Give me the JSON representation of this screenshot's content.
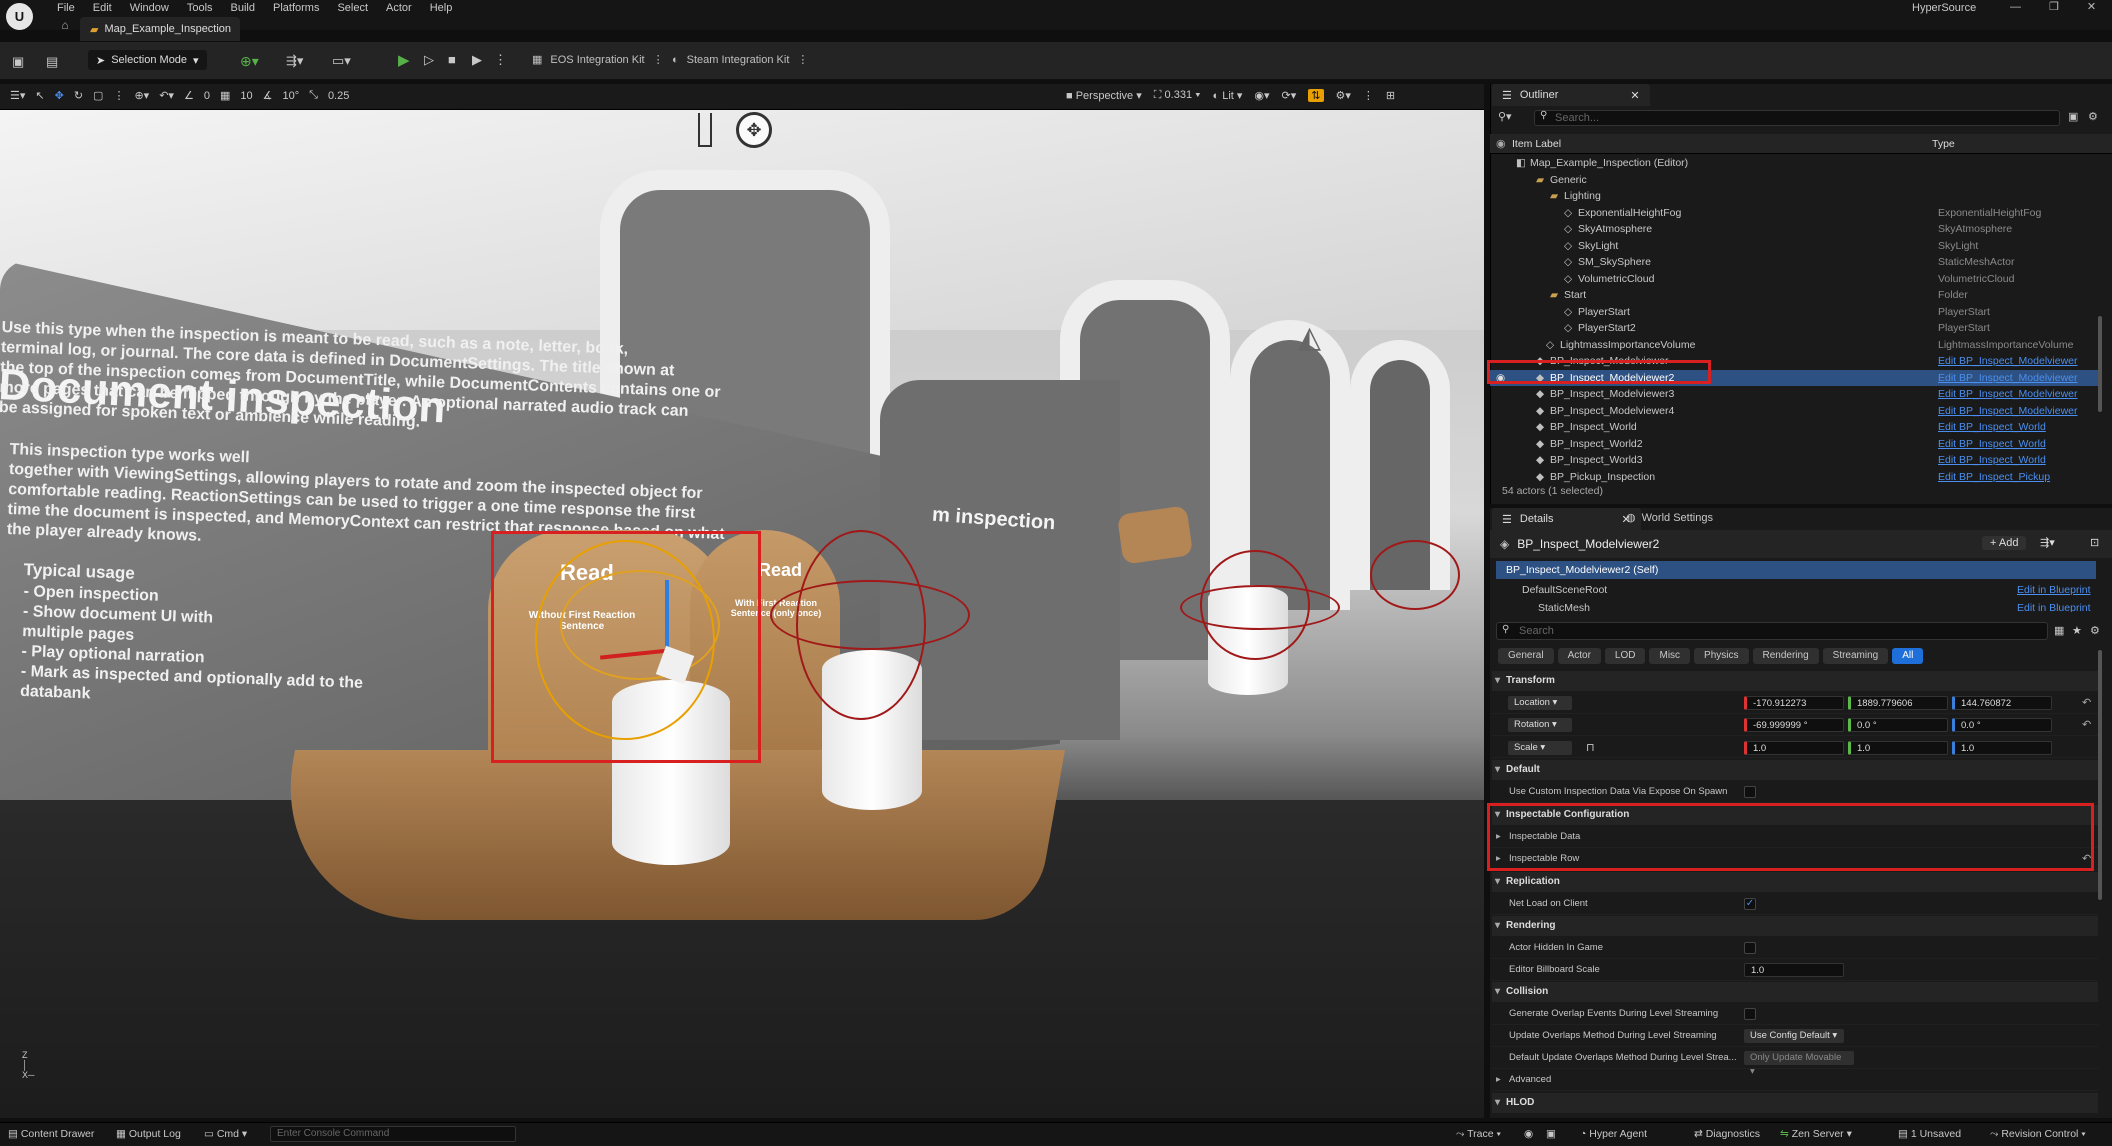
{
  "app": {
    "title": "HyperSource",
    "window_controls": [
      "—",
      "❐",
      "✕"
    ]
  },
  "menu": [
    "File",
    "Edit",
    "Window",
    "Tools",
    "Build",
    "Platforms",
    "Select",
    "Actor",
    "Help"
  ],
  "tab": {
    "label": "Map_Example_Inspection"
  },
  "toolbar": {
    "selection_mode": "Selection Mode",
    "eos": "EOS Integration Kit",
    "steam": "Steam Integration Kit"
  },
  "viewport_toolbar": {
    "snap_angle_a": "0",
    "grid_snap": "10",
    "rot_snap": "10°",
    "scale_snap": "0.25",
    "perspective": "Perspective",
    "fov": "0.331",
    "lit": "Lit"
  },
  "viewport": {
    "doc_title": "Document inspection",
    "para1": "Use this type when the inspection is meant to be read, such as a note, letter, book,\nterminal log, or journal. The core data is defined in DocumentSettings. The title shown at\nthe top of the inspection comes from DocumentTitle, while DocumentContents contains one or\nmore pages that can be flipped through by the player. An optional narrated audio track can\nbe assigned for spoken text or ambience while reading.",
    "para2": "This inspection type works well\ntogether with ViewingSettings, allowing players to rotate and zoom the inspected object for\ncomfortable reading. ReactionSettings can be used to trigger a one time response the first\ntime the document is inspected, and MemoryContext can restrict that response based on what\nthe player already knows.",
    "usage_title": "Typical usage",
    "usage": "- Open inspection\n- Show document UI with\nmultiple pages\n- Play optional narration\n- Mark as inspected and optionally add to the\ndatabank",
    "read1": "Read",
    "read1_sub": "Without First Reaction Sentence",
    "read2": "Read",
    "read2_sub": "With First Reaction Sentence (only once)",
    "mid_title": "m inspection"
  },
  "outliner": {
    "tab": "Outliner",
    "search_placeholder": "Search...",
    "col_label": "Item Label",
    "col_type": "Type",
    "rows": [
      {
        "name": "Map_Example_Inspection (Editor)",
        "type": "",
        "indent": 40,
        "icon": "map"
      },
      {
        "name": "Generic",
        "type": "",
        "indent": 60,
        "icon": "folder"
      },
      {
        "name": "Lighting",
        "type": "",
        "indent": 74,
        "icon": "folder"
      },
      {
        "name": "ExponentialHeightFog",
        "type": "ExponentialHeightFog",
        "indent": 88,
        "icon": "actor"
      },
      {
        "name": "SkyAtmosphere",
        "type": "SkyAtmosphere",
        "indent": 88,
        "icon": "actor"
      },
      {
        "name": "SkyLight",
        "type": "SkyLight",
        "indent": 88,
        "icon": "actor"
      },
      {
        "name": "SM_SkySphere",
        "type": "StaticMeshActor",
        "indent": 88,
        "icon": "actor"
      },
      {
        "name": "VolumetricCloud",
        "type": "VolumetricCloud",
        "indent": 88,
        "icon": "actor"
      },
      {
        "name": "Start",
        "type": "Folder",
        "indent": 74,
        "icon": "folder"
      },
      {
        "name": "PlayerStart",
        "type": "PlayerStart",
        "indent": 88,
        "icon": "actor"
      },
      {
        "name": "PlayerStart2",
        "type": "PlayerStart",
        "indent": 88,
        "icon": "actor"
      },
      {
        "name": "LightmassImportanceVolume",
        "type": "LightmassImportanceVolume",
        "indent": 70,
        "icon": "actor"
      },
      {
        "name": "BP_Inspect_Modelviewer",
        "type": "Edit BP_Inspect_Modelviewer",
        "indent": 60,
        "icon": "bp",
        "link": true
      },
      {
        "name": "BP_Inspect_Modelviewer2",
        "type": "Edit BP_Inspect_Modelviewer",
        "indent": 60,
        "icon": "bp",
        "link": true,
        "selected": true
      },
      {
        "name": "BP_Inspect_Modelviewer3",
        "type": "Edit BP_Inspect_Modelviewer",
        "indent": 60,
        "icon": "bp",
        "link": true
      },
      {
        "name": "BP_Inspect_Modelviewer4",
        "type": "Edit BP_Inspect_Modelviewer",
        "indent": 60,
        "icon": "bp",
        "link": true
      },
      {
        "name": "BP_Inspect_World",
        "type": "Edit BP_Inspect_World",
        "indent": 60,
        "icon": "bp",
        "link": true
      },
      {
        "name": "BP_Inspect_World2",
        "type": "Edit BP_Inspect_World",
        "indent": 60,
        "icon": "bp",
        "link": true
      },
      {
        "name": "BP_Inspect_World3",
        "type": "Edit BP_Inspect_World",
        "indent": 60,
        "icon": "bp",
        "link": true
      },
      {
        "name": "BP_Pickup_Inspection",
        "type": "Edit BP_Inspect_Pickup",
        "indent": 60,
        "icon": "bp",
        "link": true
      }
    ],
    "count": "54 actors (1 selected)"
  },
  "details": {
    "tab": "Details",
    "tab2": "World Settings",
    "actor_name": "BP_Inspect_Modelviewer2",
    "add_label": "+ Add",
    "self_row": "BP_Inspect_Modelviewer2 (Self)",
    "components": [
      {
        "name": "DefaultSceneRoot",
        "action": "Edit in Blueprint"
      },
      {
        "name": "StaticMesh",
        "action": "Edit in Blueprint"
      }
    ],
    "search_placeholder": "Search",
    "filters": [
      "General",
      "Actor",
      "LOD",
      "Misc",
      "Physics",
      "Rendering",
      "Streaming",
      "All"
    ],
    "transform": {
      "title": "Transform",
      "location_label": "Location",
      "location": [
        "-170.912273",
        "1889.779606",
        "144.760872"
      ],
      "rotation_label": "Rotation",
      "rotation": [
        "-69.999999 °",
        "0.0 °",
        "0.0 °"
      ],
      "scale_label": "Scale",
      "scale": [
        "1.0",
        "1.0",
        "1.0"
      ]
    },
    "default": {
      "title": "Default",
      "prop": "Use Custom Inspection Data Via Expose On Spawn"
    },
    "inspectable": {
      "title": "Inspectable Configuration",
      "data": "Inspectable Data",
      "row": "Inspectable Row"
    },
    "replication": {
      "title": "Replication",
      "prop": "Net Load on Client"
    },
    "rendering": {
      "title": "Rendering",
      "hidden": "Actor Hidden In Game",
      "billboard": "Editor Billboard Scale",
      "billboard_val": "1.0"
    },
    "collision": {
      "title": "Collision",
      "gen": "Generate Overlap Events During Level Streaming",
      "upd": "Update Overlaps Method During Level Streaming",
      "upd_val": "Use Config Default",
      "def": "Default Update Overlaps Method During Level Strea...",
      "def_val": "Only Update Movable"
    },
    "advanced": "Advanced",
    "hlod": "HLOD"
  },
  "statusbar": {
    "content_drawer": "Content Drawer",
    "output_log": "Output Log",
    "cmd": "Cmd",
    "console_placeholder": "Enter Console Command",
    "trace": "Trace",
    "hyper_agent": "Hyper Agent",
    "diagnostics": "Diagnostics",
    "zen": "Zen Server",
    "unsaved": "1 Unsaved",
    "revision": "Revision Control"
  }
}
